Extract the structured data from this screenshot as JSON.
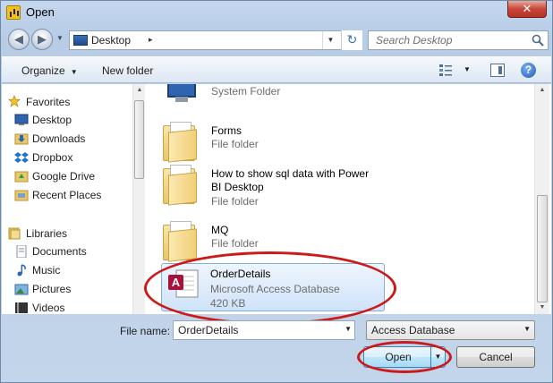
{
  "window": {
    "title": "Open",
    "close_glyph": "✕"
  },
  "address": {
    "back_glyph": "◀",
    "forward_glyph": "▶",
    "location": "Desktop",
    "separator": "▸",
    "dropdown_glyph": "▼",
    "refresh_glyph": "↻",
    "search_placeholder": "Search Desktop"
  },
  "toolbar": {
    "organize_label": "Organize",
    "new_folder_label": "New folder",
    "caret": "▼",
    "help_glyph": "?"
  },
  "nav_pane": {
    "favorites_label": "Favorites",
    "favorites": [
      "Desktop",
      "Downloads",
      "Dropbox",
      "Google Drive",
      "Recent Places"
    ],
    "libraries_label": "Libraries",
    "libraries": [
      "Documents",
      "Music",
      "Pictures",
      "Videos"
    ]
  },
  "files": {
    "top_partial": {
      "type": "System Folder"
    },
    "folders": [
      {
        "name": "Forms",
        "type": "File folder"
      },
      {
        "name": "How to show sql data with Power BI Desktop",
        "type": "File folder"
      },
      {
        "name": "MQ",
        "type": "File folder"
      }
    ],
    "selected": {
      "name": "OrderDetails",
      "type": "Microsoft Access Database",
      "size": "420 KB"
    }
  },
  "bottom": {
    "file_name_label": "File name:",
    "file_name_value": "OrderDetails",
    "file_type_value": "Access Database",
    "open_label": "Open",
    "cancel_label": "Cancel",
    "dropdown_glyph": "▼"
  },
  "colors": {
    "highlight": "#cc1a1a",
    "selection_border": "#84acdd",
    "window_frame": "#b8cce6"
  }
}
